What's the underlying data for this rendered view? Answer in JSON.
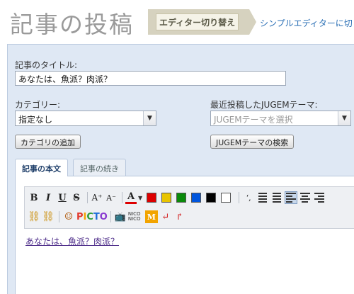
{
  "header": {
    "title": "記事の投稿",
    "editor_toggle_label": "エディター切り替え",
    "simple_editor_link": "シンプルエディターに切り"
  },
  "form": {
    "title_label": "記事のタイトル:",
    "title_value": "あなたは、魚派？肉派？",
    "category_label": "カテゴリー:",
    "category_value": "指定なし",
    "add_category_button": "カテゴリの追加",
    "theme_label": "最近投稿したJUGEMテーマ:",
    "theme_placeholder": "JUGEMテーマを選択",
    "search_theme_button": "JUGEMテーマの検索"
  },
  "tabs": [
    {
      "label": "記事の本文",
      "active": true
    },
    {
      "label": "記事の続き",
      "active": false
    }
  ],
  "toolbar": {
    "bold": "B",
    "italic": "I",
    "underline": "U",
    "strike": "S",
    "font_larger": "A⁺",
    "font_smaller": "A⁻",
    "font_color": "A",
    "color_swatches": [
      "#dd0000",
      "#e8c400",
      "#0a8a0a",
      "#0055dd",
      "#000000",
      "#ffffff"
    ],
    "picto_label": "PICTO",
    "nico_label": "NICO NICO"
  },
  "editor": {
    "body_text": "あなたは、魚派？肉派？"
  }
}
